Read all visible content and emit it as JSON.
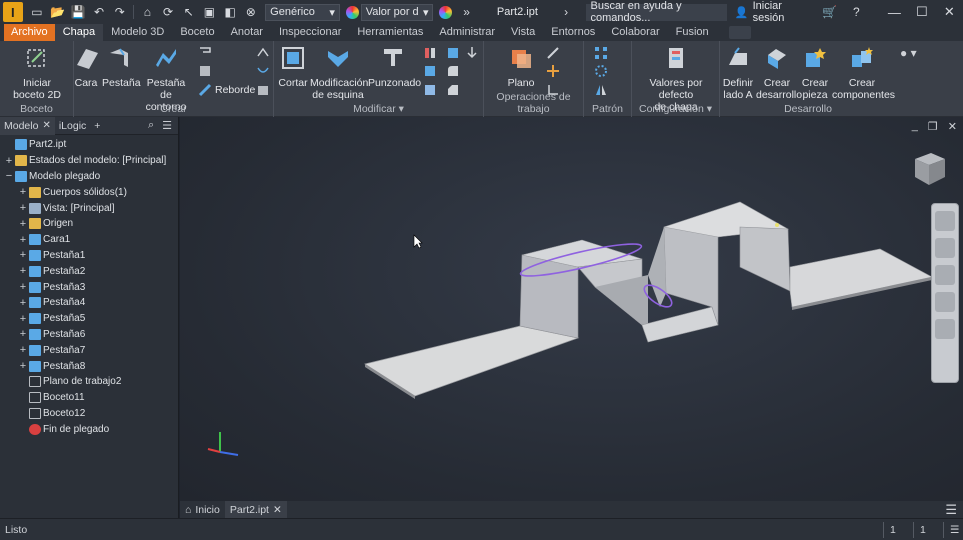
{
  "titlebar": {
    "style_select": "Genérico",
    "value_select": "Valor por d",
    "document_title": "Part2.ipt",
    "help_search_placeholder": "Buscar en ayuda y comandos...",
    "signin": "Iniciar sesión"
  },
  "ribbon_tabs": [
    "Archivo",
    "Chapa",
    "Modelo 3D",
    "Boceto",
    "Anotar",
    "Inspeccionar",
    "Herramientas",
    "Administrar",
    "Vista",
    "Entornos",
    "Colaborar",
    "Fusion"
  ],
  "ribbon": {
    "boceto": {
      "title": "Boceto",
      "start_sketch_l1": "Iniciar",
      "start_sketch_l2": "boceto 2D"
    },
    "crear": {
      "title": "Crear",
      "cara": "Cara",
      "pestana": "Pestaña",
      "pestana_contorno_l1": "Pestaña",
      "pestana_contorno_l2": "de contorno",
      "reborde": "Reborde"
    },
    "modificar": {
      "title": "Modificar",
      "cortar": "Cortar",
      "mod_esquina_l1": "Modificación",
      "mod_esquina_l2": "de esquina",
      "punzonado": "Punzonado"
    },
    "operaciones": {
      "title": "Operaciones de trabajo",
      "plano": "Plano"
    },
    "patron": {
      "title": "Patrón"
    },
    "configuracion": {
      "title": "Configuración",
      "valores_l1": "Valores por defecto",
      "valores_l2": "de chapa"
    },
    "desarrollo": {
      "title": "Desarrollo",
      "definir_l1": "Definir",
      "definir_l2": "lado A",
      "crear_des_l1": "Crear",
      "crear_des_l2": "desarrollo",
      "crear_pieza_l1": "Crear",
      "crear_pieza_l2": "pieza",
      "crear_comp_l1": "Crear",
      "crear_comp_l2": "componentes"
    }
  },
  "browser": {
    "tab_model": "Modelo",
    "tab_ilogic": "iLogic",
    "tree": [
      {
        "label": "Part2.ipt",
        "level": 0,
        "exp": "",
        "icon": "part-icon"
      },
      {
        "label": "Estados del modelo: [Principal]",
        "level": 0,
        "exp": "+",
        "icon": "folder-icon"
      },
      {
        "label": "Modelo plegado",
        "level": 0,
        "exp": "−",
        "icon": "folded-model-icon"
      },
      {
        "label": "Cuerpos sólidos(1)",
        "level": 1,
        "exp": "+",
        "icon": "solid-bodies-icon"
      },
      {
        "label": "Vista: [Principal]",
        "level": 1,
        "exp": "+",
        "icon": "view-icon"
      },
      {
        "label": "Origen",
        "level": 1,
        "exp": "+",
        "icon": "folder-icon"
      },
      {
        "label": "Cara1",
        "level": 1,
        "exp": "+",
        "icon": "face-icon"
      },
      {
        "label": "Pestaña1",
        "level": 1,
        "exp": "+",
        "icon": "flange-icon"
      },
      {
        "label": "Pestaña2",
        "level": 1,
        "exp": "+",
        "icon": "flange-icon"
      },
      {
        "label": "Pestaña3",
        "level": 1,
        "exp": "+",
        "icon": "flange-icon"
      },
      {
        "label": "Pestaña4",
        "level": 1,
        "exp": "+",
        "icon": "flange-icon"
      },
      {
        "label": "Pestaña5",
        "level": 1,
        "exp": "+",
        "icon": "flange-icon"
      },
      {
        "label": "Pestaña6",
        "level": 1,
        "exp": "+",
        "icon": "flange-icon"
      },
      {
        "label": "Pestaña7",
        "level": 1,
        "exp": "+",
        "icon": "flange-icon"
      },
      {
        "label": "Pestaña8",
        "level": 1,
        "exp": "+",
        "icon": "flange-icon"
      },
      {
        "label": "Plano de trabajo2",
        "level": 1,
        "exp": "",
        "icon": "work-plane-icon"
      },
      {
        "label": "Boceto11",
        "level": 1,
        "exp": "",
        "icon": "sketch-icon"
      },
      {
        "label": "Boceto12",
        "level": 1,
        "exp": "",
        "icon": "sketch-icon"
      },
      {
        "label": "Fin de plegado",
        "level": 1,
        "exp": "",
        "icon": "end-of-folded-icon"
      }
    ]
  },
  "doc_tabs": {
    "home": "Inicio",
    "part": "Part2.ipt"
  },
  "status": {
    "text": "Listo",
    "num1": "1",
    "num2": "1"
  },
  "colors": {
    "file_tab": "#e37222",
    "flange_icon": "#5aa9e6",
    "folder_icon": "#e2b64a",
    "end_icon": "#d94040"
  }
}
